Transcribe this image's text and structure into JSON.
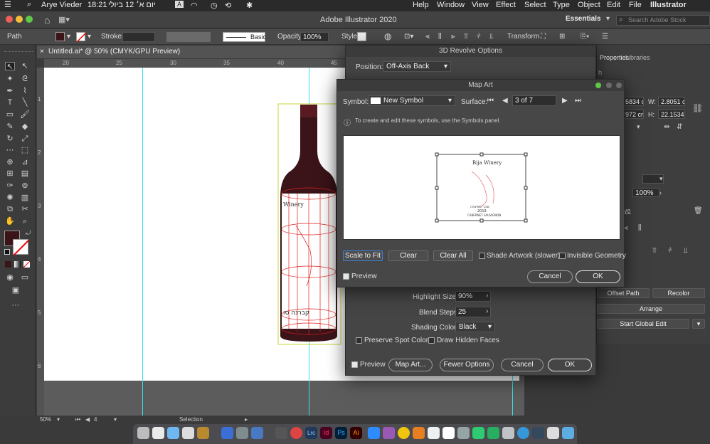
{
  "menubar": {
    "user": "Arye Vieder",
    "time": "18:21",
    "date": "יום א׳ 12 ביולי",
    "input_indicator": "A",
    "menus": [
      "Help",
      "Window",
      "View",
      "Effect",
      "Select",
      "Type",
      "Object",
      "Edit",
      "File"
    ],
    "app_name": "Illustrator"
  },
  "app": {
    "title": "Adobe Illustrator 2020",
    "workspace": "Essentials",
    "search_placeholder": "Search Adobe Stock"
  },
  "control_bar": {
    "selection_type": "Path",
    "stroke_label": "Stroke:",
    "brush_profile": "Basic",
    "opacity_label": "Opacity:",
    "opacity_value": "100%",
    "style_label": "Style:",
    "transform_label": "Transform"
  },
  "document": {
    "tab_title": "Untitled.ai* @ 50% (CMYK/GPU Preview)",
    "ruler_h": [
      "20",
      "25",
      "30",
      "35",
      "40",
      "45"
    ],
    "ruler_v": [
      "1",
      "2",
      "3",
      "4",
      "5",
      "6"
    ]
  },
  "status_bar": {
    "zoom": "50%",
    "artboard": "4",
    "tool": "Selection"
  },
  "right_panel": {
    "tabs": [
      "Properties",
      "Libraries"
    ],
    "width_label": "W:",
    "width_value": "2.8051 cn",
    "height_label": "H:",
    "height_value": "22.1534 c",
    "x_value": "5834 c",
    "y_value": "972 cr",
    "percent_value": "100%",
    "more_label": "ve",
    "offset_path": "Offset Path",
    "recolor": "Recolor",
    "arrange": "Arrange",
    "start_global_edit": "Start Global Edit"
  },
  "revolve_dialog": {
    "title": "3D Revolve Options",
    "position_label": "Position:",
    "position_value": "Off-Axis Back",
    "highlight_size_label": "Highlight Size:",
    "highlight_size_value": "90%",
    "blend_steps_label": "Blend Steps:",
    "blend_steps_value": "25",
    "shading_color_label": "Shading Color:",
    "shading_color_value": "Black",
    "preserve_spot": "Preserve Spot Colors",
    "draw_hidden": "Draw Hidden Faces",
    "preview": "Preview",
    "map_art": "Map Art...",
    "fewer_options": "Fewer Options",
    "cancel": "Cancel",
    "ok": "OK"
  },
  "map_art_dialog": {
    "title": "Map Art",
    "symbol_label": "Symbol:",
    "symbol_value": "New Symbol",
    "surface_label": "Surface:",
    "surface_value": "3 of 7",
    "info_text": "To create and edit these symbols, use the Symbols panel.",
    "label_art": {
      "line1": "Bija Winery",
      "line2": "שהר ספינוזה",
      "line3": "2019",
      "line4": "CABERNET SAUVIGNON"
    },
    "scale_to_fit": "Scale to Fit",
    "clear": "Clear",
    "clear_all": "Clear All",
    "shade_artwork": "Shade Artwork (slower)",
    "invisible_geometry": "Invisible Geometry",
    "preview": "Preview",
    "cancel": "Cancel",
    "ok": "OK"
  },
  "bottle": {
    "label_top": "Winery",
    "label_bottom": "קברנה סו"
  },
  "colors": {
    "accent": "#3b82d8",
    "guide": "#3ce0e6",
    "bottle": "#3a1418",
    "selection": "#c9d43a"
  }
}
